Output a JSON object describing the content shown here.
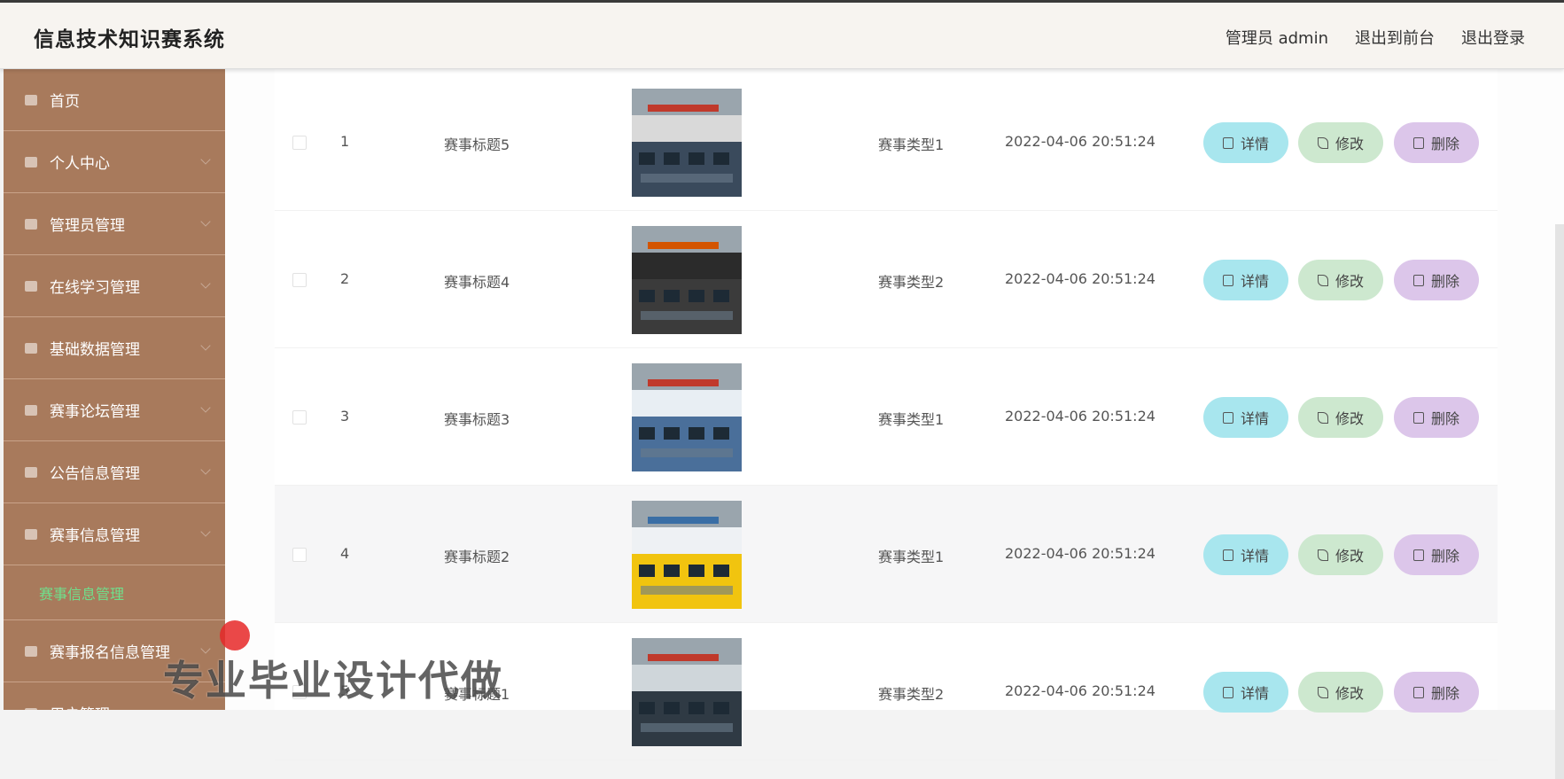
{
  "app": {
    "title": "信息技术知识赛系统",
    "admin_label": "管理员 admin",
    "back_to_front": "退出到前台",
    "logout": "退出登录"
  },
  "sidebar": {
    "items": [
      {
        "label": "首页",
        "icon": "home-icon"
      },
      {
        "label": "个人中心",
        "icon": "user-icon"
      },
      {
        "label": "管理员管理",
        "icon": "send-icon"
      },
      {
        "label": "在线学习管理",
        "icon": "grid-icon"
      },
      {
        "label": "基础数据管理",
        "icon": "database-icon"
      },
      {
        "label": "赛事论坛管理",
        "icon": "forum-icon"
      },
      {
        "label": "公告信息管理",
        "icon": "bell-icon"
      },
      {
        "label": "赛事信息管理",
        "icon": "doc-icon"
      }
    ],
    "active_sub": "赛事信息管理",
    "items_after": [
      {
        "label": "赛事报名信息管理",
        "icon": "form-icon"
      },
      {
        "label": "用户管理",
        "icon": "users-icon"
      }
    ]
  },
  "table": {
    "rows": [
      {
        "index": "1",
        "title": "赛事标题5",
        "type": "赛事类型1",
        "time": "2022-04-06 20:51:24"
      },
      {
        "index": "2",
        "title": "赛事标题4",
        "type": "赛事类型2",
        "time": "2022-04-06 20:51:24"
      },
      {
        "index": "3",
        "title": "赛事标题3",
        "type": "赛事类型1",
        "time": "2022-04-06 20:51:24"
      },
      {
        "index": "4",
        "title": "赛事标题2",
        "type": "赛事类型1",
        "time": "2022-04-06 20:51:24"
      },
      {
        "index": "5",
        "title": "赛事标题1",
        "type": "赛事类型2",
        "time": "2022-04-06 20:51:24"
      }
    ],
    "actions": {
      "detail": "详情",
      "edit": "修改",
      "delete": "删除"
    }
  },
  "watermark": "专业毕业设计代做",
  "colors": {
    "sidebar": "#a87a5c",
    "active_sub": "#6fe08c",
    "detail_btn": "#a8e6ee",
    "edit_btn": "#cde8cf",
    "delete_btn": "#dcc6ea"
  }
}
